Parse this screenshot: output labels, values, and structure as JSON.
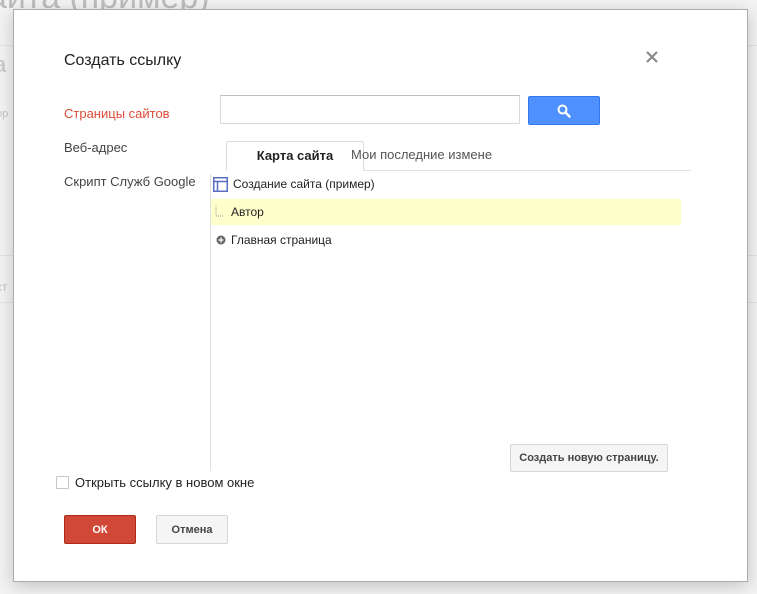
{
  "background": {
    "title_fragment": "айта (пример)",
    "fragment_1": "а",
    "fragment_2": "ор",
    "fragment_3": "ст"
  },
  "dialog": {
    "title": "Создать ссылку",
    "close_icon": "close-icon",
    "nav": [
      {
        "label": "Страницы сайтов",
        "active": true
      },
      {
        "label": "Веб-адрес",
        "active": false
      },
      {
        "label": "Скрипт Служб Google",
        "active": false
      }
    ],
    "search": {
      "value": "",
      "placeholder": "",
      "button_icon": "search-icon"
    },
    "tabs": [
      {
        "label": "Карта сайта",
        "active": true
      },
      {
        "label": "Мои последние измене",
        "active": false
      }
    ],
    "tree": [
      {
        "label": "Создание сайта (пример)",
        "icon": "site-icon"
      },
      {
        "label": "Автор",
        "icon": "tree-branch-icon",
        "selected": true
      },
      {
        "label": "Главная страница",
        "icon": "expand-plus-icon"
      }
    ],
    "new_page_button": "Создать новую страницу.",
    "open_new_window": {
      "label": "Открыть ссылку в новом окне",
      "checked": false
    },
    "ok_button": "ОК",
    "cancel_button": "Отмена"
  },
  "colors": {
    "active_nav": "#dd4b39",
    "search_button": "#4d90fe",
    "ok_button": "#d14836",
    "selected_row": "#ffffcc"
  }
}
